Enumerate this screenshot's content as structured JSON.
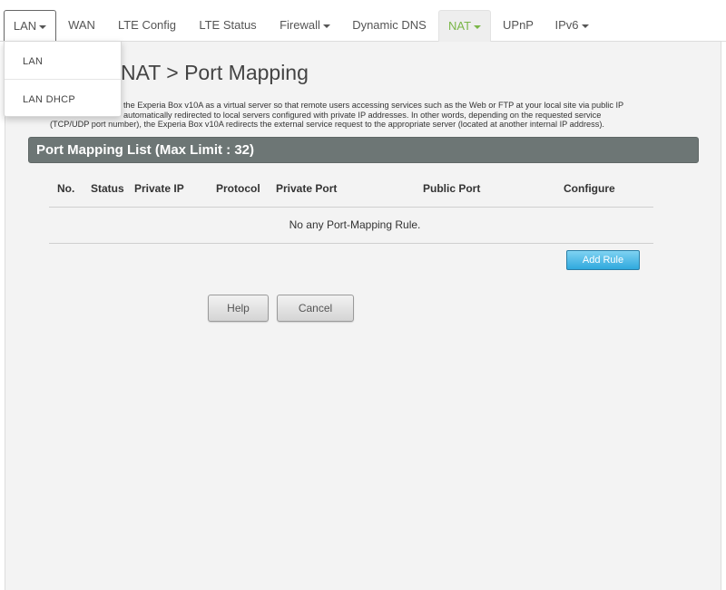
{
  "nav": {
    "tabs": [
      {
        "label": "LAN",
        "caret": true
      },
      {
        "label": "WAN",
        "caret": false
      },
      {
        "label": "LTE Config",
        "caret": false
      },
      {
        "label": "LTE Status",
        "caret": false
      },
      {
        "label": "Firewall",
        "caret": true
      },
      {
        "label": "Dynamic DNS",
        "caret": false
      },
      {
        "label": "NAT",
        "caret": true
      },
      {
        "label": "UPnP",
        "caret": false
      },
      {
        "label": "IPv6",
        "caret": true
      }
    ],
    "active_tab": "NAT",
    "open_menu": "LAN",
    "active_color": "#7ab648"
  },
  "dropdown": {
    "items": [
      "LAN",
      "LAN DHCP"
    ]
  },
  "page": {
    "title": "NAT > Port Mapping",
    "description_line1": "the Experia Box v10A as a virtual server so that remote users accessing services such as the Web or FTP at your local site via public IP",
    "description_line2": "automatically redirected to local servers configured with private IP addresses. In other words, depending on the requested service",
    "description_line3": "(TCP/UDP port number), the Experia Box v10A redirects the external service request to the appropriate server (located at another internal IP address)."
  },
  "list": {
    "header": "Port Mapping List (Max Limit : 32)",
    "columns": [
      "No.",
      "Status",
      "Private IP",
      "Protocol",
      "Private Port",
      "Public Port",
      "Configure"
    ],
    "empty_message": "No any Port-Mapping Rule.",
    "rows": []
  },
  "buttons": {
    "add_rule": "Add Rule",
    "help": "Help",
    "cancel": "Cancel"
  },
  "colors": {
    "header_bar": "#6d7675",
    "add_button": "#43b6e6",
    "panel_bg": "#f3f3f3"
  }
}
